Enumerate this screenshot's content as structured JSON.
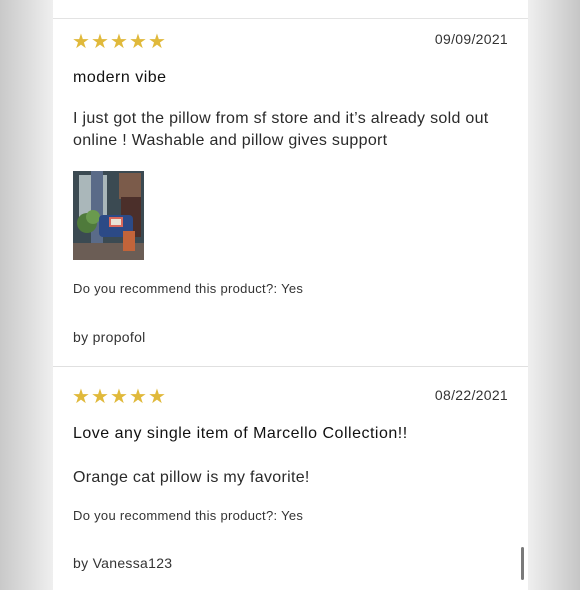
{
  "reviews": [
    {
      "rating": 5,
      "date": "09/09/2021",
      "title": "modern vibe",
      "body": "I just got the pillow from sf store and it’s already sold out online ! Washable and pillow gives support",
      "recommend": "Do you recommend this product?: Yes",
      "author": "by propofol"
    },
    {
      "rating": 5,
      "date": "08/22/2021",
      "title": "Love any single item of Marcello Collection!!",
      "body": "Orange cat pillow is my favorite!",
      "recommend": "Do you recommend this product?: Yes",
      "author": "by Vanessa123"
    }
  ],
  "colors": {
    "star": "#e0b93b",
    "text": "#333333",
    "divider": "#e0e0e0"
  },
  "icons": {
    "star": "star-icon"
  }
}
